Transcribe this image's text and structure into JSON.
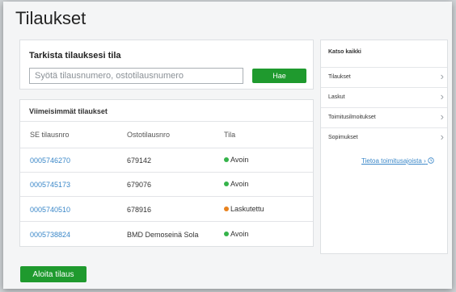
{
  "page": {
    "title": "Tilaukset"
  },
  "check_order": {
    "title": "Tarkista tilauksesi tila",
    "input_placeholder": "Syötä tilausnumero, ostotilausnumero",
    "button_label": "Hae"
  },
  "recent_orders": {
    "title": "Viimeisimmät tilaukset",
    "columns": [
      "SE tilausnro",
      "Ostotilausnro",
      "Tila"
    ],
    "rows": [
      {
        "order_no": "0005746270",
        "po_no": "679142",
        "status": "Avoin",
        "status_color": "#35b34a"
      },
      {
        "order_no": "0005745173",
        "po_no": "679076",
        "status": "Avoin",
        "status_color": "#35b34a"
      },
      {
        "order_no": "0005740510",
        "po_no": "678916",
        "status": "Laskutettu",
        "status_color": "#e8821e"
      },
      {
        "order_no": "0005738824",
        "po_no": "BMD Demoseinä Sola",
        "status": "Avoin",
        "status_color": "#35b34a"
      }
    ]
  },
  "sidebar": {
    "title": "Katso kaikki",
    "items": [
      {
        "label": "Tilaukset"
      },
      {
        "label": "Laskut"
      },
      {
        "label": "Toimitusilmoitukset"
      },
      {
        "label": "Sopimukset"
      }
    ],
    "link": {
      "label": "Tietoa toimitusajoista",
      "icon": "clock-icon"
    }
  },
  "actions": {
    "start_order": "Aloita tilaus"
  },
  "colors": {
    "accent_green": "#1f9a2e",
    "link_blue": "#3a87c8",
    "status_open": "#35b34a",
    "status_invoiced": "#e8821e"
  }
}
